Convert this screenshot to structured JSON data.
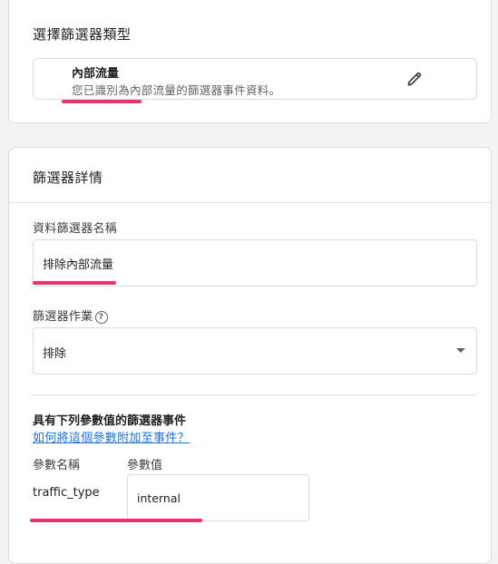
{
  "filter_type": {
    "title": "選擇篩選器類型",
    "name": "內部流量",
    "description": "您已識別為內部流量的篩選器事件資料。"
  },
  "details": {
    "title": "篩選器詳情",
    "name_label": "資料篩選器名稱",
    "name_value": "排除內部流量",
    "operation_label": "篩選器作業",
    "operation_value": "排除",
    "events_heading": "具有下列參數值的篩選器事件",
    "events_link": "如何將這個參數附加至事件？",
    "param_name_header": "參數名稱",
    "param_value_header": "參數值",
    "param_name": "traffic_type",
    "param_value": "internal"
  },
  "colors": {
    "highlight": "#e8336d",
    "link": "#1a73e8"
  },
  "icons": {
    "edit": "pencil-icon",
    "help": "help-circle-icon",
    "dropdown": "dropdown-arrow-icon"
  }
}
